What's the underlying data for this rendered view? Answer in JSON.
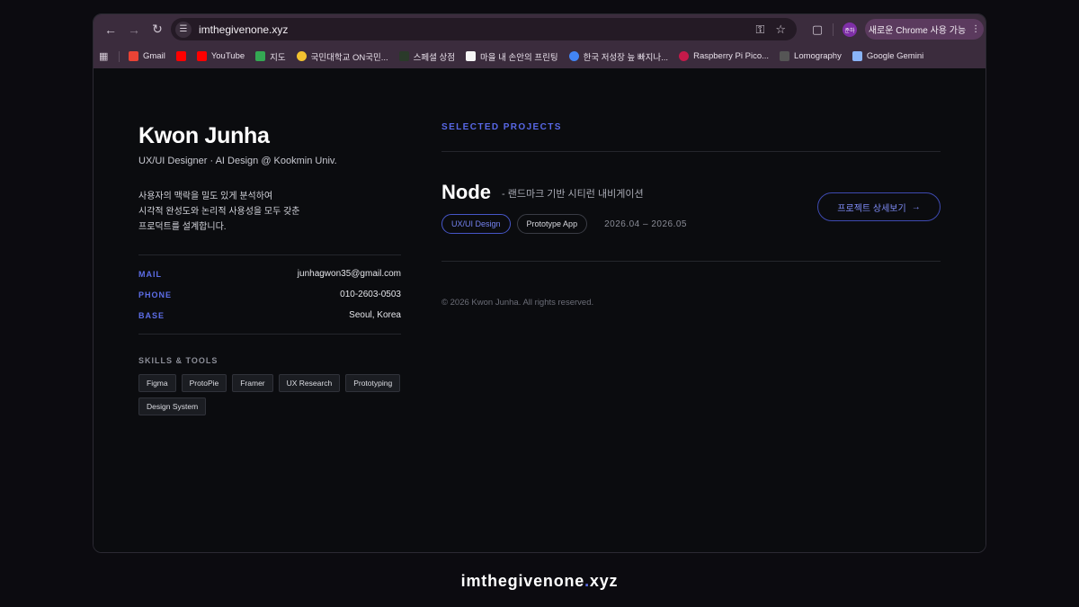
{
  "browser": {
    "url": "imthegivenone.xyz",
    "update_label": "새로운 Chrome 사용 가능",
    "profile_initials": "준하",
    "bookmarks": [
      {
        "label": "Gmail",
        "color": "#ea4335"
      },
      {
        "label": "",
        "color": "#ff0000"
      },
      {
        "label": "YouTube",
        "color": "#ff0000"
      },
      {
        "label": "지도",
        "color": "#34a853"
      },
      {
        "label": "국민대학교 ON국민...",
        "color": "#f2c230"
      },
      {
        "label": "스페셜 상점",
        "color": "#2a3a2a"
      },
      {
        "label": "마을 내 손안의 프린팅",
        "color": "#f5f5f5"
      },
      {
        "label": "한국 저성장 늪 빠지나...",
        "color": "#4285f4"
      },
      {
        "label": "Raspberry Pi Pico...",
        "color": "#c51a4a"
      },
      {
        "label": "Lomography",
        "color": "#555555"
      },
      {
        "label": "Google Gemini",
        "color": "#8ab4f8"
      }
    ]
  },
  "profile": {
    "name": "Kwon Junha",
    "subtitle": "UX/UI Designer · AI Design @ Kookmin Univ.",
    "bio": [
      "사용자의 맥락을 밀도 있게 분석하여",
      "시각적 완성도와 논리적 사용성을 모두 갖춘",
      "프로덕트를 설계합니다."
    ],
    "contact": [
      {
        "label": "MAIL",
        "value": "junhagwon35@gmail.com"
      },
      {
        "label": "PHONE",
        "value": "010-2603-0503"
      },
      {
        "label": "BASE",
        "value": "Seoul, Korea"
      }
    ],
    "skills_title": "SKILLS & TOOLS",
    "skills": [
      "Figma",
      "ProtoPie",
      "Framer",
      "UX Research",
      "Prototyping",
      "Design System"
    ]
  },
  "projects": {
    "section_title": "SELECTED PROJECTS",
    "items": [
      {
        "name": "Node",
        "description": "- 랜드마크 기반 시티런 내비게이션",
        "tags": [
          "UX/UI Design",
          "Prototype App"
        ],
        "date": "2026.04 – 2026.05",
        "detail_label": "프로젝트 상세보기",
        "detail_arrow": "→"
      }
    ]
  },
  "copyright": "© 2026 Kwon Junha. All rights reserved.",
  "footer": {
    "left": "imthegivenone",
    "dot": ".",
    "right": "xyz"
  },
  "colors": {
    "accent": "#5d6ee8",
    "chrome": "#3b2c3d",
    "background": "#0b0c0f"
  }
}
